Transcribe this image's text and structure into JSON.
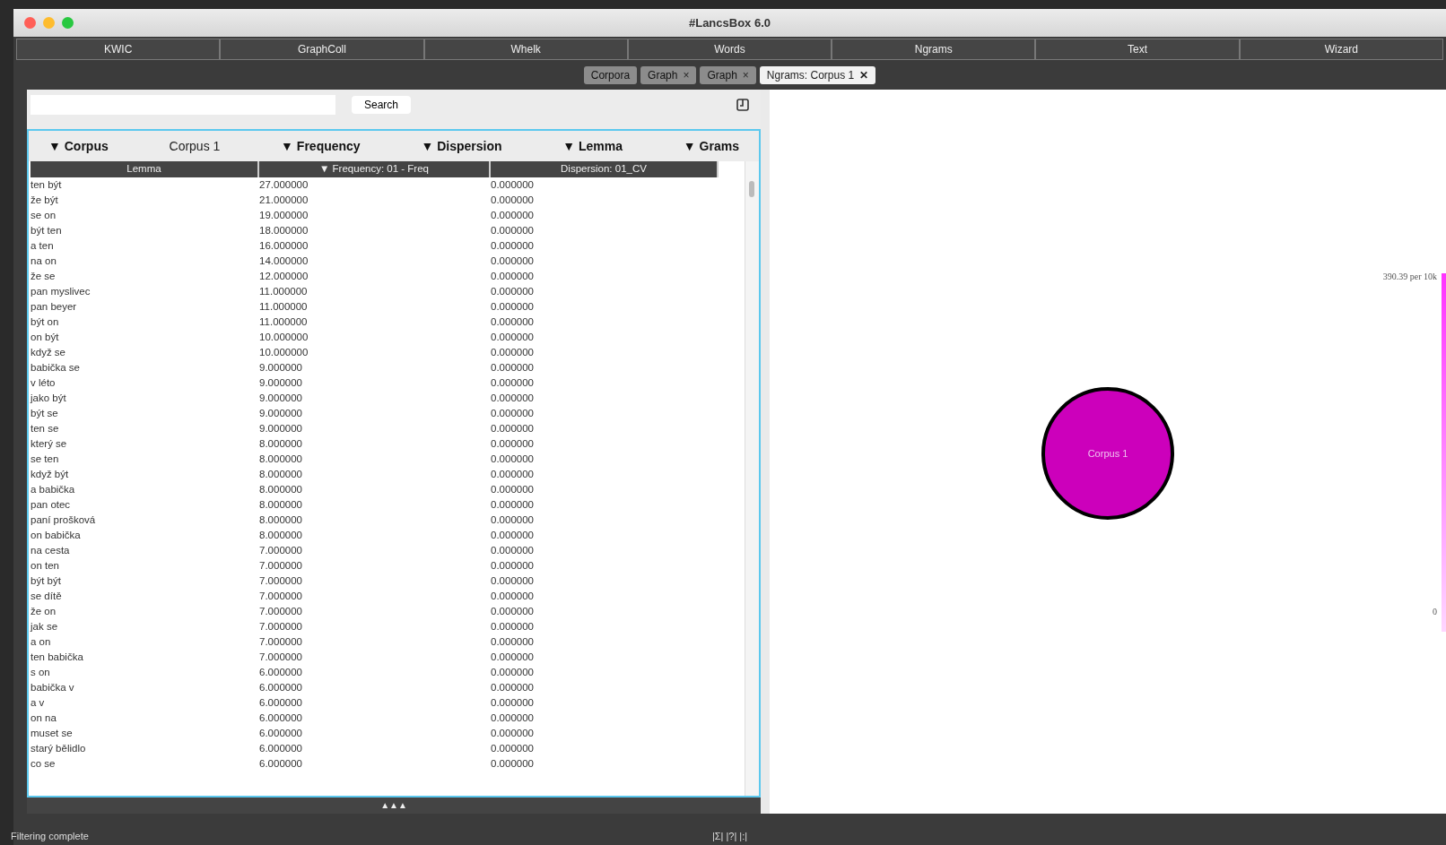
{
  "window": {
    "title": "#LancsBox 6.0"
  },
  "main_tabs": [
    {
      "label": "KWIC"
    },
    {
      "label": "GraphColl"
    },
    {
      "label": "Whelk"
    },
    {
      "label": "Words"
    },
    {
      "label": "Ngrams"
    },
    {
      "label": "Text"
    },
    {
      "label": "Wizard"
    }
  ],
  "sub_tabs": [
    {
      "label": "Corpora",
      "selected": false
    },
    {
      "label": "Graph",
      "close": "×",
      "selected": false
    },
    {
      "label": "Graph",
      "close": "×",
      "selected": false
    },
    {
      "label": "Ngrams: Corpus 1",
      "close": "✕",
      "selected": true
    }
  ],
  "search": {
    "button": "Search"
  },
  "filters": [
    {
      "label": "▼ Corpus",
      "value": "Corpus 1"
    },
    {
      "label": "▼ Frequency"
    },
    {
      "label": "▼ Dispersion"
    },
    {
      "label": "▼ Lemma"
    },
    {
      "label": "▼ Grams"
    }
  ],
  "table": {
    "columns": [
      "Lemma",
      "▼ Frequency: 01 - Freq",
      "Dispersion: 01_CV"
    ],
    "rows": [
      [
        "ten být",
        "27.000000",
        "0.000000"
      ],
      [
        "že být",
        "21.000000",
        "0.000000"
      ],
      [
        "se on",
        "19.000000",
        "0.000000"
      ],
      [
        "být ten",
        "18.000000",
        "0.000000"
      ],
      [
        "a ten",
        "16.000000",
        "0.000000"
      ],
      [
        "na on",
        "14.000000",
        "0.000000"
      ],
      [
        "že se",
        "12.000000",
        "0.000000"
      ],
      [
        "pan myslivec",
        "11.000000",
        "0.000000"
      ],
      [
        "pan beyer",
        "11.000000",
        "0.000000"
      ],
      [
        "být on",
        "11.000000",
        "0.000000"
      ],
      [
        "on být",
        "10.000000",
        "0.000000"
      ],
      [
        "když se",
        "10.000000",
        "0.000000"
      ],
      [
        "babička se",
        "9.000000",
        "0.000000"
      ],
      [
        "v léto",
        "9.000000",
        "0.000000"
      ],
      [
        "jako být",
        "9.000000",
        "0.000000"
      ],
      [
        "být se",
        "9.000000",
        "0.000000"
      ],
      [
        "ten se",
        "9.000000",
        "0.000000"
      ],
      [
        "který se",
        "8.000000",
        "0.000000"
      ],
      [
        "se ten",
        "8.000000",
        "0.000000"
      ],
      [
        "když být",
        "8.000000",
        "0.000000"
      ],
      [
        "a babička",
        "8.000000",
        "0.000000"
      ],
      [
        "pan otec",
        "8.000000",
        "0.000000"
      ],
      [
        "paní prošková",
        "8.000000",
        "0.000000"
      ],
      [
        "on babička",
        "8.000000",
        "0.000000"
      ],
      [
        "na cesta",
        "7.000000",
        "0.000000"
      ],
      [
        "on ten",
        "7.000000",
        "0.000000"
      ],
      [
        "být být",
        "7.000000",
        "0.000000"
      ],
      [
        "se dítě",
        "7.000000",
        "0.000000"
      ],
      [
        "že on",
        "7.000000",
        "0.000000"
      ],
      [
        "jak se",
        "7.000000",
        "0.000000"
      ],
      [
        "a on",
        "7.000000",
        "0.000000"
      ],
      [
        "ten babička",
        "7.000000",
        "0.000000"
      ],
      [
        "s on",
        "6.000000",
        "0.000000"
      ],
      [
        "babička v",
        "6.000000",
        "0.000000"
      ],
      [
        "a v",
        "6.000000",
        "0.000000"
      ],
      [
        "on na",
        "6.000000",
        "0.000000"
      ],
      [
        "muset se",
        "6.000000",
        "0.000000"
      ],
      [
        "starý bělidlo",
        "6.000000",
        "0.000000"
      ],
      [
        "co se",
        "6.000000",
        "0.000000"
      ]
    ]
  },
  "collapse_toggle": "▲▲▲",
  "graph": {
    "nodes": [
      {
        "label": "Corpus 1"
      }
    ],
    "legend": {
      "max_label": "390.39 per 10k",
      "min_label": "0"
    }
  },
  "status_bar": {
    "message": "Filtering complete",
    "indicators": "|Σ| |?| |:|"
  }
}
